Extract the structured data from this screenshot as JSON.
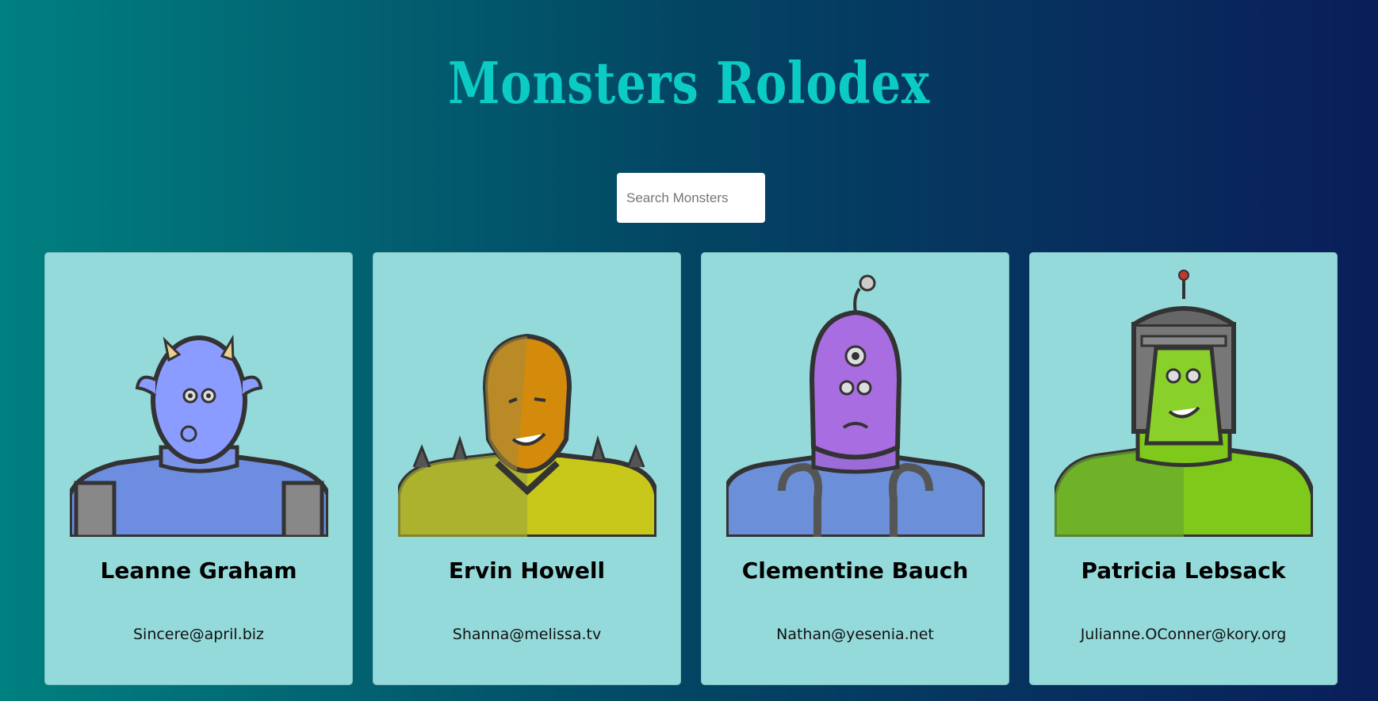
{
  "app": {
    "title": "Monsters Rolodex"
  },
  "search": {
    "placeholder": "Search Monsters",
    "value": ""
  },
  "monsters": [
    {
      "name": "Leanne Graham",
      "email": "Sincere@april.biz"
    },
    {
      "name": "Ervin Howell",
      "email": "Shanna@melissa.tv"
    },
    {
      "name": "Clementine Bauch",
      "email": "Nathan@yesenia.net"
    },
    {
      "name": "Patricia Lebsack",
      "email": "Julianne.OConner@kory.org"
    }
  ],
  "colors": {
    "background_start": "#008080",
    "background_end": "#0a1e5a",
    "title": "#0ccac4",
    "card": "#95dada"
  }
}
